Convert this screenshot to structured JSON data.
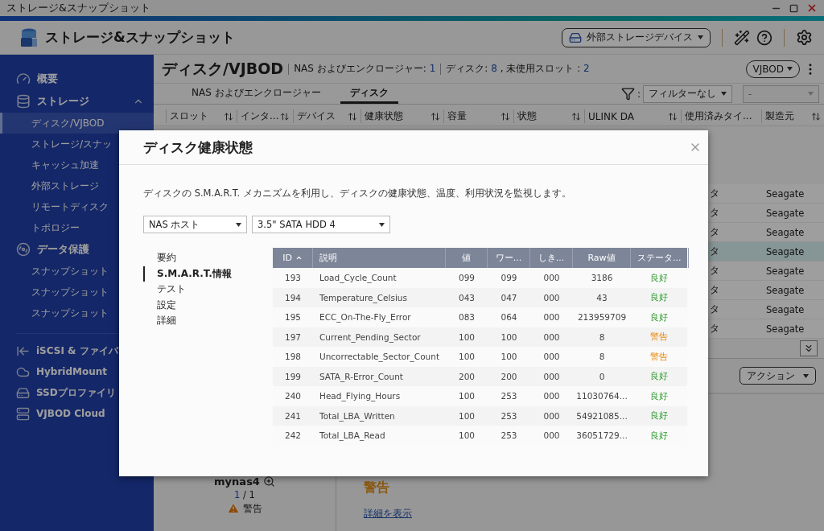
{
  "window": {
    "title": "ストレージ&スナップショット"
  },
  "app_header": {
    "title": "ストレージ&スナップショット",
    "device_button": "外部ストレージデバイス"
  },
  "sidebar": {
    "sections": [
      {
        "label": "概要"
      },
      {
        "label": "ストレージ",
        "expanded": true,
        "children": [
          {
            "label": "ディスク/VJBOD",
            "selected": true
          },
          {
            "label": "ストレージ/スナッ",
            "selected": false
          },
          {
            "label": "キャッシュ加速",
            "selected": false
          },
          {
            "label": "外部ストレージ",
            "selected": false
          },
          {
            "label": "リモートディスク",
            "selected": false
          },
          {
            "label": "トポロジー",
            "selected": false
          }
        ]
      },
      {
        "label": "データ保護",
        "children": [
          {
            "label": "スナップショット",
            "selected": false
          },
          {
            "label": "スナップショット",
            "selected": false
          },
          {
            "label": "スナップショット",
            "selected": false
          }
        ]
      }
    ],
    "apps": [
      {
        "label": "iSCSI & ファイバ"
      },
      {
        "label": "HybridMount"
      },
      {
        "label": "SSDプロファイリ"
      },
      {
        "label": "VJBOD Cloud"
      }
    ]
  },
  "page": {
    "title": "ディスク/VJBOD",
    "stats": [
      {
        "label": "NAS およびエンクロージャー:",
        "value": "1",
        "divider": true
      },
      {
        "label": "ディスク:",
        "value": "8",
        "divider": true
      },
      {
        "label": ", 未使用スロット :",
        "value": "2",
        "divider": false
      }
    ],
    "mode_button": "VJBOD"
  },
  "tabs": [
    {
      "label": "NAS およびエンクロージャー",
      "selected": false
    },
    {
      "label": "ディスク",
      "selected": true
    }
  ],
  "filter": {
    "separator": ":",
    "value": "フィルターなし",
    "secondary": {
      "value": "-",
      "disabled": true
    }
  },
  "disk_table": {
    "columns": [
      {
        "label": "スロット",
        "sortable": true
      },
      {
        "label": "インタ...",
        "sortable": true
      },
      {
        "label": "デバイス",
        "sortable": true
      },
      {
        "label": "健康状態",
        "sortable": true
      },
      {
        "label": "容量",
        "sortable": true
      },
      {
        "label": "状態",
        "sortable": true
      },
      {
        "label": "ULINK DA",
        "sortable": true
      },
      {
        "label": "使用済みタイ...",
        "sortable": false
      },
      {
        "label": "製造元",
        "sortable": true
      }
    ],
    "rows": [
      {
        "used_type": "タ",
        "manufacturer": "Seagate",
        "selected": false
      },
      {
        "used_type": "タ",
        "manufacturer": "Seagate",
        "selected": false
      },
      {
        "used_type": "タ",
        "manufacturer": "Seagate",
        "selected": false
      },
      {
        "used_type": "タ",
        "manufacturer": "Seagate",
        "selected": true
      },
      {
        "used_type": "タ",
        "manufacturer": "Seagate",
        "selected": false
      },
      {
        "used_type": "タ",
        "manufacturer": "Seagate",
        "selected": false
      },
      {
        "used_type": "タ",
        "manufacturer": "Seagate",
        "selected": false
      },
      {
        "used_type": "タ",
        "manufacturer": "Seagate",
        "selected": false
      }
    ]
  },
  "detail_panel": {
    "action_button": "アクション",
    "nas": {
      "name": "mynas4",
      "current": "1",
      "separator": "/",
      "total": "1",
      "status": "警告"
    },
    "health": "警告",
    "details_link": "詳細を表示"
  },
  "modal": {
    "title": "ディスク健康状態",
    "description": "ディスクの S.M.A.R.T. メカニズムを利用し、ディスクの健康状態、温度、利用状況を監視します。",
    "selects": [
      "NAS ホスト",
      "3.5\" SATA HDD 4"
    ],
    "nav": [
      {
        "label": "要約",
        "selected": false
      },
      {
        "label": "S.M.A.R.T.情報",
        "selected": true
      },
      {
        "label": "テスト",
        "selected": false
      },
      {
        "label": "設定",
        "selected": false
      },
      {
        "label": "詳細",
        "selected": false
      }
    ],
    "smart_table": {
      "columns": [
        {
          "label": "ID",
          "sorted": true
        },
        {
          "label": "説明",
          "sorted": false
        },
        {
          "label": "値",
          "sorted": false
        },
        {
          "label": "ワー...",
          "sorted": false
        },
        {
          "label": "しき...",
          "sorted": false
        },
        {
          "label": "Raw値",
          "sorted": false
        },
        {
          "label": "ステータ...",
          "sorted": false
        }
      ],
      "rows": [
        {
          "id": "193",
          "description": "Load_Cycle_Count",
          "value": "099",
          "worst": "099",
          "threshold": "000",
          "raw": "3186",
          "status": "良好",
          "alert": false
        },
        {
          "id": "194",
          "description": "Temperature_Celsius",
          "value": "043",
          "worst": "047",
          "threshold": "000",
          "raw": "43",
          "status": "良好",
          "alert": false
        },
        {
          "id": "195",
          "description": "ECC_On-The-Fly_Error",
          "value": "083",
          "worst": "064",
          "threshold": "000",
          "raw": "213959709",
          "status": "良好",
          "alert": false
        },
        {
          "id": "197",
          "description": "Current_Pending_Sector",
          "value": "100",
          "worst": "100",
          "threshold": "000",
          "raw": "8",
          "status": "警告",
          "alert": true
        },
        {
          "id": "198",
          "description": "Uncorrectable_Sector_Count",
          "value": "100",
          "worst": "100",
          "threshold": "000",
          "raw": "8",
          "status": "警告",
          "alert": true
        },
        {
          "id": "199",
          "description": "SATA_R-Error_Count",
          "value": "200",
          "worst": "200",
          "threshold": "000",
          "raw": "0",
          "status": "良好",
          "alert": false
        },
        {
          "id": "240",
          "description": "Head_Flying_Hours",
          "value": "100",
          "worst": "253",
          "threshold": "000",
          "raw": "11030764...",
          "status": "良好",
          "alert": false
        },
        {
          "id": "241",
          "description": "Total_LBA_Written",
          "value": "100",
          "worst": "253",
          "threshold": "000",
          "raw": "54921085...",
          "status": "良好",
          "alert": false
        },
        {
          "id": "242",
          "description": "Total_LBA_Read",
          "value": "100",
          "worst": "253",
          "threshold": "000",
          "raw": "36051729...",
          "status": "良好",
          "alert": false
        }
      ]
    }
  }
}
